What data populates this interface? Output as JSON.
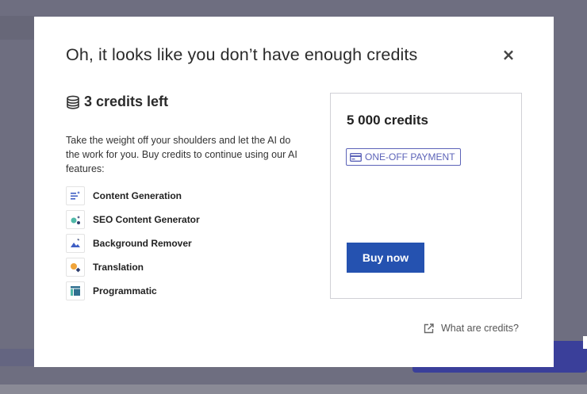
{
  "modal": {
    "title": "Oh, it looks like you don’t have enough credits",
    "close_symbol": "×",
    "close_icon": "close-icon",
    "credits_left": "3 credits left",
    "credits_icon": "coins-stack-icon",
    "description": "Take the weight off your shoulders and let the AI do the work for you. Buy credits to continue using our AI features:",
    "features": [
      {
        "label": "Content Generation",
        "icon": "content-generation-icon"
      },
      {
        "label": "SEO Content Generator",
        "icon": "seo-content-icon"
      },
      {
        "label": "Background Remover",
        "icon": "background-remover-icon"
      },
      {
        "label": "Translation",
        "icon": "translation-icon"
      },
      {
        "label": "Programmatic",
        "icon": "programmatic-icon"
      }
    ],
    "plan": {
      "credits": "5 000 credits",
      "badge": "ONE-OFF PAYMENT",
      "badge_icon": "credit-card-icon",
      "buy_label": "Buy now"
    },
    "help_link": "What are credits?",
    "help_icon": "external-link-icon"
  },
  "colors": {
    "primary": "#2552b0",
    "badge": "#5c63b8",
    "overlay": "#6e6e80"
  }
}
